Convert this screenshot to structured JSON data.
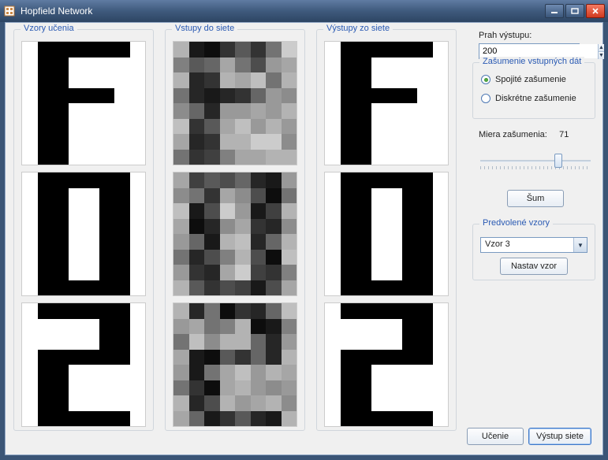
{
  "window": {
    "title": "Hopfield Network"
  },
  "groups": {
    "train": "Vzory učenia",
    "input": "Vstupy do siete",
    "output": "Výstupy zo siete",
    "noise": "Zašumenie vstupných dát",
    "presets": "Predvolené vzory"
  },
  "threshold": {
    "label": "Prah výstupu:",
    "value": "200"
  },
  "noise": {
    "continuous": "Spojité zašumenie",
    "discrete": "Diskrétne zašumenie",
    "selected": "continuous",
    "slider_label": "Miera zašumenia:",
    "slider_value": "71",
    "apply_btn": "Šum"
  },
  "presets": {
    "selected": "Vzor 3",
    "set_btn": "Nastav vzor"
  },
  "buttons": {
    "learn": "Učenie",
    "output": "Výstup siete"
  },
  "patterns": {
    "F": [
      [
        0,
        1,
        1,
        1,
        1,
        1,
        1,
        0
      ],
      [
        0,
        1,
        1,
        0,
        0,
        0,
        0,
        0
      ],
      [
        0,
        1,
        1,
        0,
        0,
        0,
        0,
        0
      ],
      [
        0,
        1,
        1,
        1,
        1,
        1,
        0,
        0
      ],
      [
        0,
        1,
        1,
        0,
        0,
        0,
        0,
        0
      ],
      [
        0,
        1,
        1,
        0,
        0,
        0,
        0,
        0
      ],
      [
        0,
        1,
        1,
        0,
        0,
        0,
        0,
        0
      ],
      [
        0,
        1,
        1,
        0,
        0,
        0,
        0,
        0
      ]
    ],
    "O": [
      [
        0,
        1,
        1,
        1,
        1,
        1,
        1,
        0
      ],
      [
        0,
        1,
        1,
        0,
        0,
        1,
        1,
        0
      ],
      [
        0,
        1,
        1,
        0,
        0,
        1,
        1,
        0
      ],
      [
        0,
        1,
        1,
        0,
        0,
        1,
        1,
        0
      ],
      [
        0,
        1,
        1,
        0,
        0,
        1,
        1,
        0
      ],
      [
        0,
        1,
        1,
        0,
        0,
        1,
        1,
        0
      ],
      [
        0,
        1,
        1,
        0,
        0,
        1,
        1,
        0
      ],
      [
        0,
        1,
        1,
        1,
        1,
        1,
        1,
        0
      ]
    ],
    "Two": [
      [
        0,
        1,
        1,
        1,
        1,
        1,
        1,
        0
      ],
      [
        0,
        0,
        0,
        0,
        0,
        1,
        1,
        0
      ],
      [
        0,
        0,
        0,
        0,
        0,
        1,
        1,
        0
      ],
      [
        0,
        1,
        1,
        1,
        1,
        1,
        1,
        0
      ],
      [
        0,
        1,
        1,
        0,
        0,
        0,
        0,
        0
      ],
      [
        0,
        1,
        1,
        0,
        0,
        0,
        0,
        0
      ],
      [
        0,
        1,
        1,
        0,
        0,
        0,
        0,
        0
      ],
      [
        0,
        1,
        1,
        1,
        1,
        1,
        1,
        0
      ]
    ],
    "noisyF": [
      [
        0.3,
        0.9,
        0.95,
        0.8,
        0.65,
        0.8,
        0.55,
        0.2
      ],
      [
        0.5,
        0.65,
        0.6,
        0.35,
        0.55,
        0.7,
        0.4,
        0.35
      ],
      [
        0.3,
        0.85,
        0.8,
        0.3,
        0.35,
        0.25,
        0.55,
        0.3
      ],
      [
        0.55,
        0.85,
        0.9,
        0.85,
        0.8,
        0.6,
        0.4,
        0.45
      ],
      [
        0.45,
        0.6,
        0.85,
        0.4,
        0.4,
        0.35,
        0.4,
        0.3
      ],
      [
        0.25,
        0.8,
        0.65,
        0.35,
        0.25,
        0.4,
        0.3,
        0.4
      ],
      [
        0.35,
        0.85,
        0.8,
        0.3,
        0.3,
        0.2,
        0.2,
        0.45
      ],
      [
        0.55,
        0.8,
        0.75,
        0.5,
        0.35,
        0.35,
        0.3,
        0.3
      ]
    ],
    "noisyO": [
      [
        0.35,
        0.75,
        0.65,
        0.7,
        0.6,
        0.85,
        0.9,
        0.4
      ],
      [
        0.45,
        0.55,
        0.8,
        0.35,
        0.45,
        0.7,
        0.95,
        0.55
      ],
      [
        0.25,
        0.9,
        0.7,
        0.2,
        0.4,
        0.9,
        0.75,
        0.3
      ],
      [
        0.35,
        0.95,
        0.85,
        0.45,
        0.35,
        0.8,
        0.85,
        0.45
      ],
      [
        0.4,
        0.6,
        0.9,
        0.3,
        0.25,
        0.85,
        0.6,
        0.3
      ],
      [
        0.55,
        0.85,
        0.7,
        0.5,
        0.3,
        0.7,
        0.95,
        0.25
      ],
      [
        0.4,
        0.8,
        0.85,
        0.35,
        0.2,
        0.75,
        0.8,
        0.5
      ],
      [
        0.3,
        0.65,
        0.8,
        0.7,
        0.75,
        0.9,
        0.7,
        0.35
      ]
    ],
    "noisyTwo": [
      [
        0.3,
        0.85,
        0.55,
        0.95,
        0.8,
        0.85,
        0.6,
        0.25
      ],
      [
        0.4,
        0.35,
        0.55,
        0.5,
        0.3,
        0.95,
        0.9,
        0.5
      ],
      [
        0.55,
        0.25,
        0.45,
        0.3,
        0.3,
        0.6,
        0.85,
        0.4
      ],
      [
        0.35,
        0.9,
        0.95,
        0.65,
        0.8,
        0.6,
        0.85,
        0.3
      ],
      [
        0.4,
        0.9,
        0.55,
        0.35,
        0.25,
        0.4,
        0.3,
        0.35
      ],
      [
        0.55,
        0.8,
        0.95,
        0.35,
        0.3,
        0.4,
        0.45,
        0.4
      ],
      [
        0.3,
        0.85,
        0.7,
        0.3,
        0.4,
        0.35,
        0.3,
        0.45
      ],
      [
        0.35,
        0.6,
        0.9,
        0.8,
        0.65,
        0.85,
        0.9,
        0.3
      ]
    ]
  },
  "columns": {
    "train": [
      "F",
      "O",
      "Two"
    ],
    "input": [
      "noisyF",
      "noisyO",
      "noisyTwo"
    ],
    "output": [
      "F",
      "O",
      "Two"
    ]
  }
}
